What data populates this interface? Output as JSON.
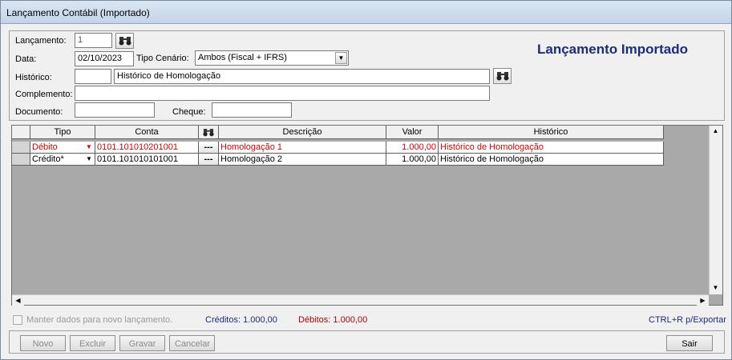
{
  "window": {
    "title": "Lançamento Contábil (Importado)"
  },
  "header": {
    "heading": "Lançamento Importado",
    "lancamento_label": "Lançamento:",
    "lancamento_value": "1",
    "data_label": "Data:",
    "data_value": "02/10/2023",
    "tipo_cenario_label": "Tipo Cenário:",
    "tipo_cenario_value": "Ambos (Fiscal + IFRS)",
    "historico_label": "Histórico:",
    "historico_code": "",
    "historico_value": "Histórico de Homologação",
    "complemento_label": "Complemento:",
    "complemento_value": "",
    "documento_label": "Documento:",
    "documento_value": "",
    "cheque_label": "Cheque:",
    "cheque_value": ""
  },
  "grid": {
    "columns": [
      "Tipo",
      "Conta",
      "",
      "Descrição",
      "Valor",
      "Histórico"
    ],
    "rows": [
      {
        "tipo": "Débito",
        "conta": "0101.101010201001",
        "descricao": "Homologação 1",
        "valor": "1.000,00",
        "historico": "Histórico de Homologação",
        "color": "#d40000"
      },
      {
        "tipo": "Crédito*",
        "conta": "0101.101010101001",
        "descricao": "Homologação 2",
        "valor": "1.000,00",
        "historico": "Histórico de Homologação",
        "color": "#000000"
      }
    ],
    "lookup_button": "---"
  },
  "footer": {
    "keep_data_label": "Manter dados para novo lançamento.",
    "creditos": "Créditos: 1.000,00",
    "debitos": "Débitos: 1.000,00",
    "shortcut": "CTRL+R p/Exportar"
  },
  "buttons": {
    "novo": "Novo",
    "excluir": "Excluir",
    "gravar": "Gravar",
    "cancelar": "Cancelar",
    "sair": "Sair"
  },
  "colors": {
    "heading": "#1c2c7c",
    "debit": "#d40000",
    "credit_total": "#1c2c7c"
  },
  "icons": {
    "search": "binoculars-icon"
  }
}
